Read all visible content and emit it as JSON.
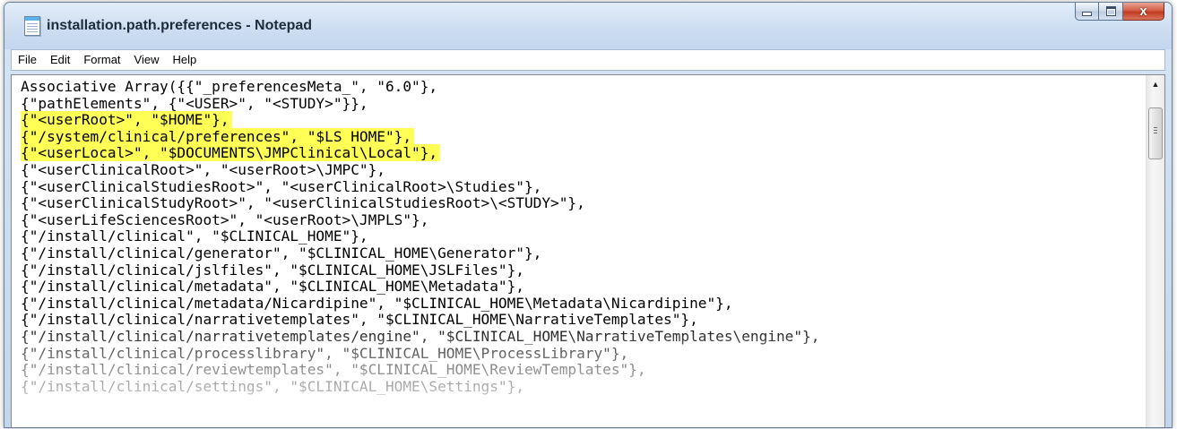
{
  "window": {
    "title": "installation.path.preferences - Notepad",
    "controls": {
      "minimize": "minimize",
      "maximize": "maximize",
      "close": "x"
    }
  },
  "menu": [
    "File",
    "Edit",
    "Format",
    "View",
    "Help"
  ],
  "editor": {
    "lines": [
      {
        "text": "Associative Array({{\"_preferencesMeta_\", \"6.0\"},",
        "highlighted": false
      },
      {
        "text": "{\"pathElements\", {\"<USER>\", \"<STUDY>\"}},",
        "highlighted": false
      },
      {
        "text": "{\"<userRoot>\", \"$HOME\"},",
        "highlighted": true
      },
      {
        "text": "{\"/system/clinical/preferences\", \"$LS_HOME\"},",
        "highlighted": true
      },
      {
        "text": "{\"<userLocal>\", \"$DOCUMENTS\\JMPClinical\\Local\"},",
        "highlighted": true
      },
      {
        "text": "{\"<userClinicalRoot>\", \"<userRoot>\\JMPC\"},",
        "highlighted": false
      },
      {
        "text": "{\"<userClinicalStudiesRoot>\", \"<userClinicalRoot>\\Studies\"},",
        "highlighted": false
      },
      {
        "text": "{\"<userClinicalStudyRoot>\", \"<userClinicalStudiesRoot>\\<STUDY>\"},",
        "highlighted": false
      },
      {
        "text": "{\"<userLifeSciencesRoot>\", \"<userRoot>\\JMPLS\"},",
        "highlighted": false
      },
      {
        "text": "{\"/install/clinical\", \"$CLINICAL_HOME\"},",
        "highlighted": false
      },
      {
        "text": "{\"/install/clinical/generator\", \"$CLINICAL_HOME\\Generator\"},",
        "highlighted": false
      },
      {
        "text": "{\"/install/clinical/jslfiles\", \"$CLINICAL_HOME\\JSLFiles\"},",
        "highlighted": false
      },
      {
        "text": "{\"/install/clinical/metadata\", \"$CLINICAL_HOME\\Metadata\"},",
        "highlighted": false
      },
      {
        "text": "{\"/install/clinical/metadata/Nicardipine\", \"$CLINICAL_HOME\\Metadata\\Nicardipine\"},",
        "highlighted": false
      },
      {
        "text": "{\"/install/clinical/narrativetemplates\", \"$CLINICAL_HOME\\NarrativeTemplates\"},",
        "highlighted": false
      },
      {
        "text": "{\"/install/clinical/narrativetemplates/engine\", \"$CLINICAL_HOME\\NarrativeTemplates\\engine\"},",
        "highlighted": false
      },
      {
        "text": "{\"/install/clinical/processlibrary\", \"$CLINICAL_HOME\\ProcessLibrary\"},",
        "highlighted": false
      },
      {
        "text": "{\"/install/clinical/reviewtemplates\", \"$CLINICAL_HOME\\ReviewTemplates\"},",
        "highlighted": false
      },
      {
        "text": "{\"/install/clinical/settings\", \"$CLINICAL_HOME\\Settings\"},",
        "highlighted": false
      }
    ],
    "highlight_color": "#ffff55"
  },
  "icons": {
    "app": "notepad-icon",
    "scroll_up": "scroll-up-arrow-icon",
    "scroll_thumb": "scroll-thumb-grip-icon"
  }
}
